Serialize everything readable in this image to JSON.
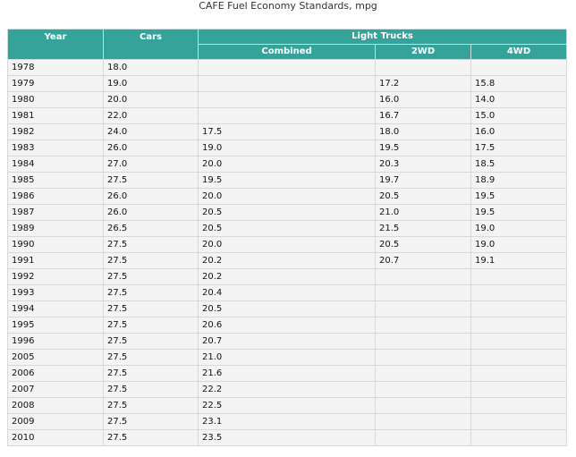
{
  "title": "CAFE Fuel Economy Standards, mpg",
  "colors": {
    "header_bg": "#36a39b",
    "header_text": "#ffffff",
    "cell_bg": "#f4f4f4",
    "grid": "#d9d9d9"
  },
  "headers": {
    "year": "Year",
    "cars": "Cars",
    "light_trucks": "Light Trucks",
    "combined": "Combined",
    "twowd": "2WD",
    "fourwd": "4WD"
  },
  "rows": [
    {
      "year": "1978",
      "cars": "18.0",
      "combined": "",
      "twowd": "",
      "fourwd": ""
    },
    {
      "year": "1979",
      "cars": "19.0",
      "combined": "",
      "twowd": "17.2",
      "fourwd": "15.8"
    },
    {
      "year": "1980",
      "cars": "20.0",
      "combined": "",
      "twowd": "16.0",
      "fourwd": "14.0"
    },
    {
      "year": "1981",
      "cars": "22.0",
      "combined": "",
      "twowd": "16.7",
      "fourwd": "15.0"
    },
    {
      "year": "1982",
      "cars": "24.0",
      "combined": "17.5",
      "twowd": "18.0",
      "fourwd": "16.0"
    },
    {
      "year": "1983",
      "cars": "26.0",
      "combined": "19.0",
      "twowd": "19.5",
      "fourwd": "17.5"
    },
    {
      "year": "1984",
      "cars": "27.0",
      "combined": "20.0",
      "twowd": "20.3",
      "fourwd": "18.5"
    },
    {
      "year": "1985",
      "cars": "27.5",
      "combined": "19.5",
      "twowd": "19.7",
      "fourwd": "18.9"
    },
    {
      "year": "1986",
      "cars": "26.0",
      "combined": "20.0",
      "twowd": "20.5",
      "fourwd": "19.5"
    },
    {
      "year": "1987",
      "cars": "26.0",
      "combined": "20.5",
      "twowd": "21.0",
      "fourwd": "19.5"
    },
    {
      "year": "1989",
      "cars": "26.5",
      "combined": "20.5",
      "twowd": "21.5",
      "fourwd": "19.0"
    },
    {
      "year": "1990",
      "cars": "27.5",
      "combined": "20.0",
      "twowd": "20.5",
      "fourwd": "19.0"
    },
    {
      "year": "1991",
      "cars": "27.5",
      "combined": "20.2",
      "twowd": "20.7",
      "fourwd": "19.1"
    },
    {
      "year": "1992",
      "cars": "27.5",
      "combined": "20.2",
      "twowd": "",
      "fourwd": ""
    },
    {
      "year": "1993",
      "cars": "27.5",
      "combined": "20.4",
      "twowd": "",
      "fourwd": ""
    },
    {
      "year": "1994",
      "cars": "27.5",
      "combined": "20.5",
      "twowd": "",
      "fourwd": ""
    },
    {
      "year": "1995",
      "cars": "27.5",
      "combined": "20.6",
      "twowd": "",
      "fourwd": ""
    },
    {
      "year": "1996",
      "cars": "27.5",
      "combined": "20.7",
      "twowd": "",
      "fourwd": ""
    },
    {
      "year": "2005",
      "cars": "27.5",
      "combined": "21.0",
      "twowd": "",
      "fourwd": ""
    },
    {
      "year": "2006",
      "cars": "27.5",
      "combined": "21.6",
      "twowd": "",
      "fourwd": ""
    },
    {
      "year": "2007",
      "cars": "27.5",
      "combined": "22.2",
      "twowd": "",
      "fourwd": ""
    },
    {
      "year": "2008",
      "cars": "27.5",
      "combined": "22.5",
      "twowd": "",
      "fourwd": ""
    },
    {
      "year": "2009",
      "cars": "27.5",
      "combined": "23.1",
      "twowd": "",
      "fourwd": ""
    },
    {
      "year": "2010",
      "cars": "27.5",
      "combined": "23.5",
      "twowd": "",
      "fourwd": ""
    }
  ]
}
